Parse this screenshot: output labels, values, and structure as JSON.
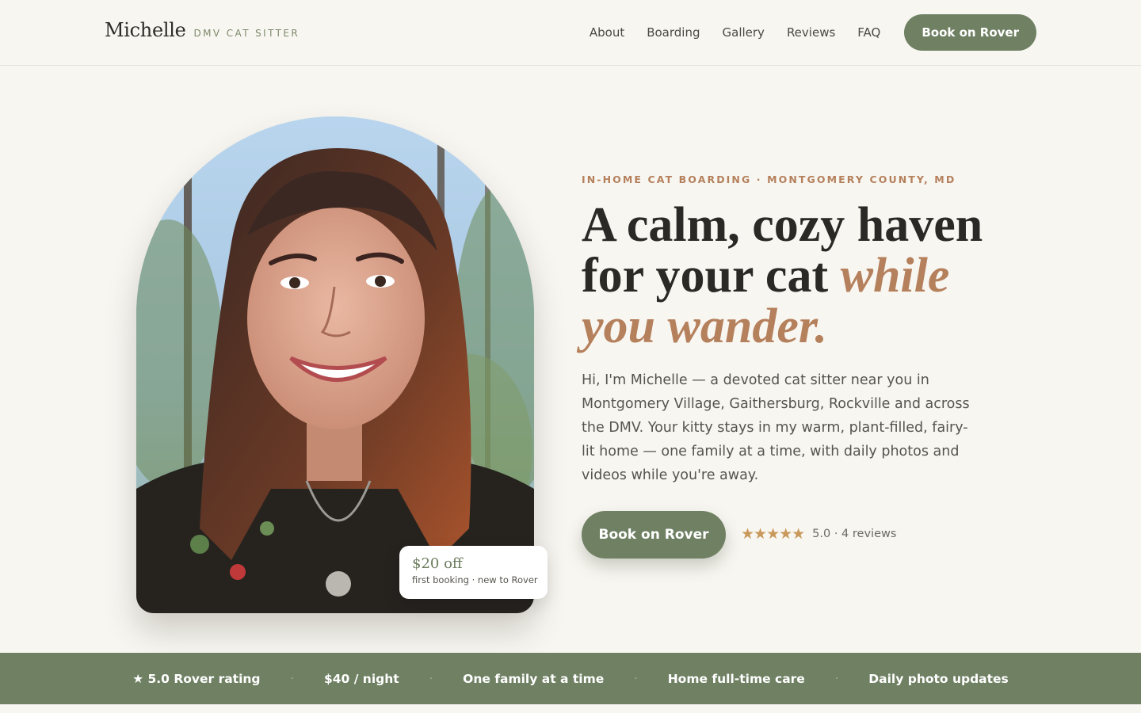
{
  "header": {
    "brand_name": "Michelle",
    "brand_tag": "DMV CAT SITTER",
    "nav": [
      "About",
      "Boarding",
      "Gallery",
      "Reviews",
      "FAQ"
    ],
    "cta": "Book on Rover"
  },
  "hero": {
    "eyebrow": "IN-HOME CAT BOARDING · MONTGOMERY COUNTY, MD",
    "headline_1": "A calm, cozy haven",
    "headline_2": "for your cat ",
    "headline_accent_1": "while",
    "headline_accent_2": "you wander.",
    "lead": "Hi, I'm Michelle — a devoted cat sitter near you in Montgomery Village, Gaithersburg, Rockville and across the DMV. Your kitty stays in my warm, plant-filled, fairy-lit home — one family at a time, with daily photos and videos while you're away.",
    "cta": "Book on Rover",
    "stars": "★★★★★",
    "rating_text": "5.0 · 4 reviews",
    "badge_title": "$20 off",
    "badge_sub": "first booking · new to Rover"
  },
  "strip": [
    "★ 5.0 Rover rating",
    "$40 / night",
    "One family at a time",
    "Home full-time care",
    "Daily photo updates"
  ],
  "strip_separator": "·",
  "colors": {
    "background": "#f8f6f1",
    "sage": "#6f8063",
    "terracotta": "#b5805c",
    "star": "#c9995c"
  }
}
